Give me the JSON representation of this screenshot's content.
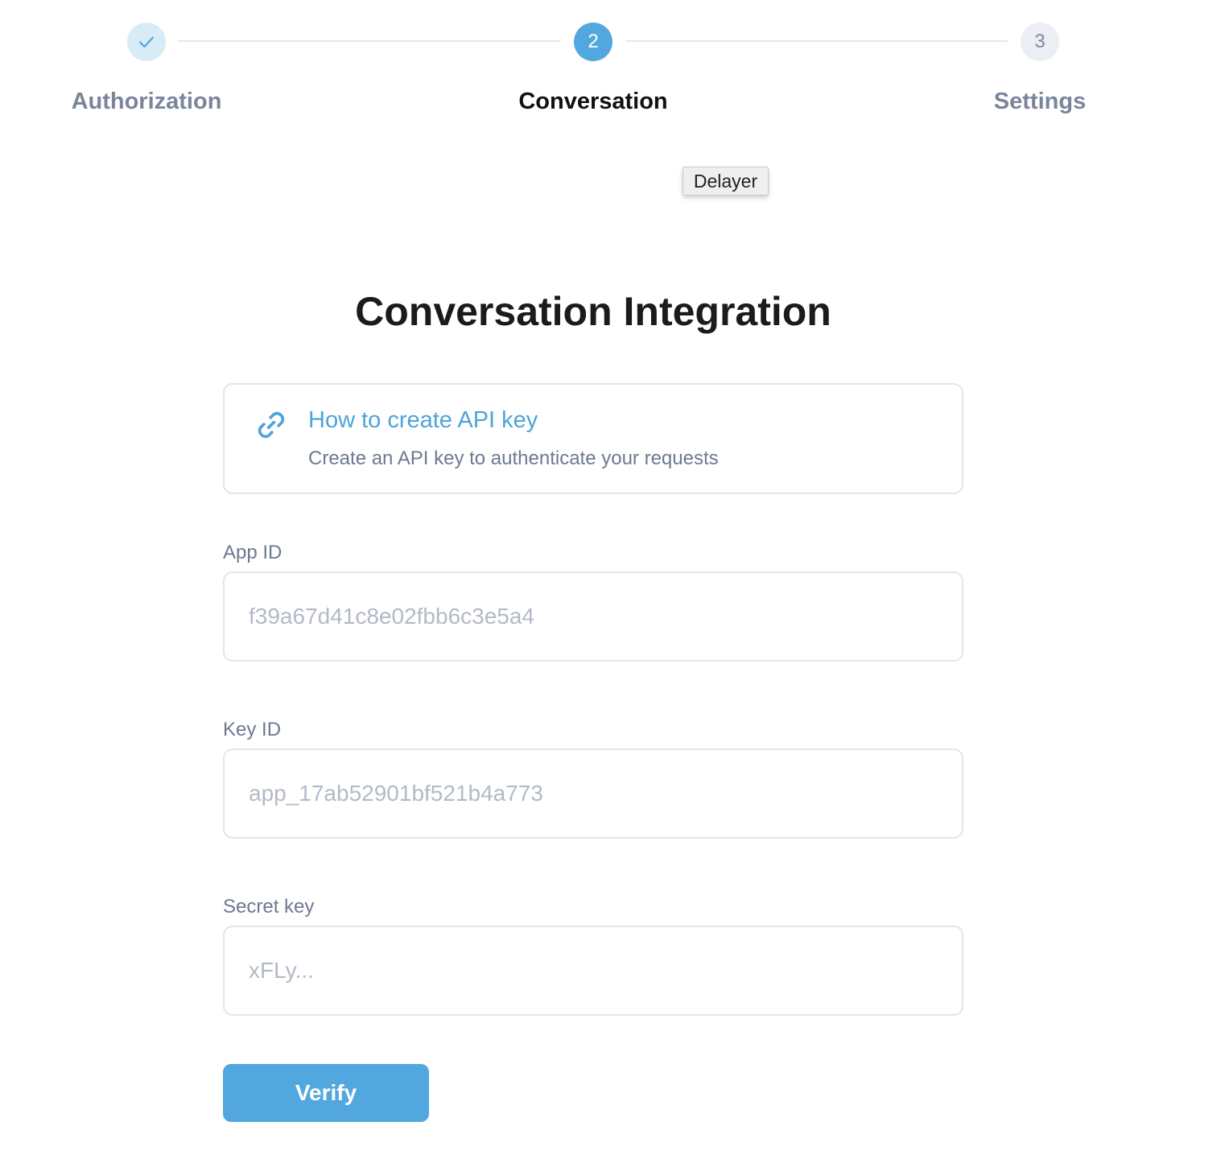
{
  "stepper": {
    "steps": [
      {
        "label": "Authorization",
        "number": "",
        "status": "completed",
        "icon": "check-icon"
      },
      {
        "label": "Conversation",
        "number": "2",
        "status": "active"
      },
      {
        "label": "Settings",
        "number": "3",
        "status": "pending"
      }
    ]
  },
  "tooltip": {
    "text": "Delayer"
  },
  "page": {
    "title": "Conversation Integration"
  },
  "help_card": {
    "icon": "link-icon",
    "title": "How to create API key",
    "description": "Create an API key to authenticate your requests"
  },
  "form": {
    "app_id": {
      "label": "App ID",
      "placeholder": "f39a67d41c8e02fbb6c3e5a4",
      "value": ""
    },
    "key_id": {
      "label": "Key ID",
      "placeholder": "app_17ab52901bf521b4a773",
      "value": ""
    },
    "secret_key": {
      "label": "Secret key",
      "placeholder": "xFLy...",
      "value": ""
    },
    "verify_label": "Verify"
  },
  "colors": {
    "accent": "#52a8de",
    "completed_step_bg": "#d8ecf8",
    "pending_step_bg": "#eceef6",
    "muted_text": "#7a859b",
    "border": "#e3e5ea"
  }
}
